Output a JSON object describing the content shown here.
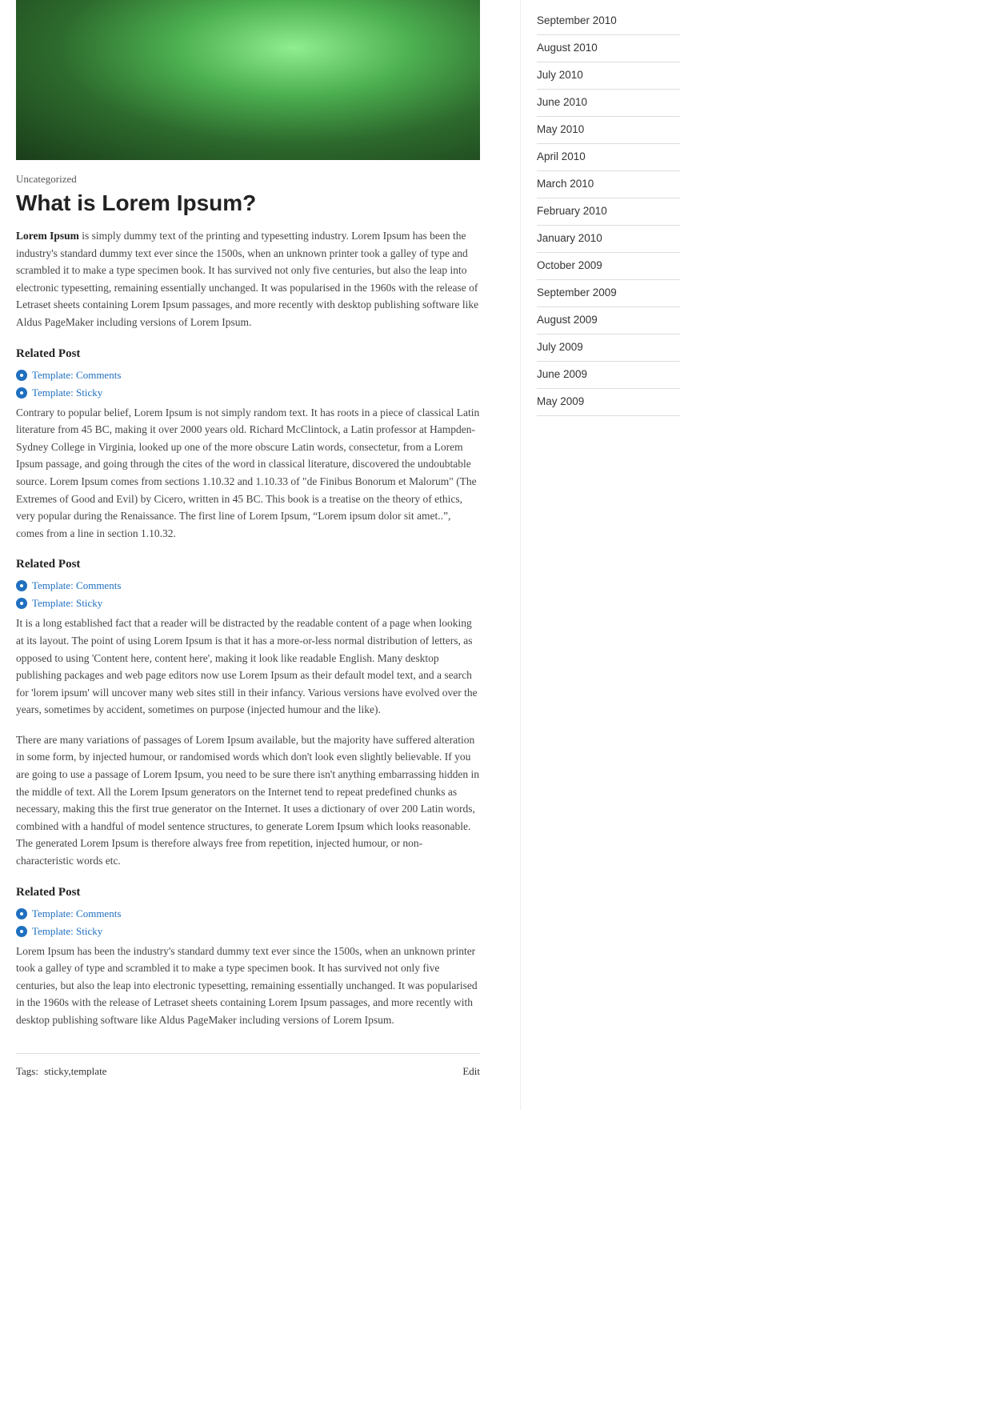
{
  "hero": {
    "alt": "Lorem Ipsum hero image"
  },
  "post": {
    "category": "Uncategorized",
    "title": "What is Lorem Ipsum?",
    "body1": "Lorem Ipsum is simply dummy text of the printing and typesetting industry. Lorem Ipsum has been the industry's standard dummy text ever since the 1500s, when an unknown printer took a galley of type and scrambled it to make a type specimen book. It has survived not only five centuries, but also the leap into electronic typesetting, remaining essentially unchanged. It was popularised in the 1960s with the release of Letraset sheets containing Lorem Ipsum passages, and more recently with desktop publishing software like Aldus PageMaker including versions of Lorem Ipsum.",
    "related_post_1": "Related Post",
    "related_link_1a": "Template: Comments",
    "related_link_1b": "Template: Sticky",
    "body2": "Contrary to popular belief, Lorem Ipsum is not simply random text. It has roots in a piece of classical Latin literature from 45 BC, making it over 2000 years old. Richard McClintock, a Latin professor at Hampden-Sydney College in Virginia, looked up one of the more obscure Latin words, consectetur, from a Lorem Ipsum passage, and going through the cites of the word in classical literature, discovered the undoubtable source. Lorem Ipsum comes from sections 1.10.32 and 1.10.33 of \"de Finibus Bonorum et Malorum\" (The Extremes of Good and Evil) by Cicero, written in 45 BC. This book is a treatise on the theory of ethics, very popular during the Renaissance. The first line of Lorem Ipsum, “Lorem ipsum dolor sit amet..”, comes from a line in section 1.10.32.",
    "related_post_2": "Related Post",
    "related_link_2a": "Template: Comments",
    "related_link_2b": "Template: Sticky",
    "body3": "It is a long established fact that a reader will be distracted by the readable content of a page when looking at its layout. The point of using Lorem Ipsum is that it has a more-or-less normal distribution of letters, as opposed to using 'Content here, content here', making it look like readable English. Many desktop publishing packages and web page editors now use Lorem Ipsum as their default model text, and a search for 'lorem ipsum' will uncover many web sites still in their infancy. Various versions have evolved over the years, sometimes by accident, sometimes on purpose (injected humour and the like).",
    "body4": "There are many variations of passages of Lorem Ipsum available, but the majority have suffered alteration in some form, by injected humour, or randomised words which don't look even slightly believable. If you are going to use a passage of Lorem Ipsum, you need to be sure there isn't anything embarrassing hidden in the middle of text. All the Lorem Ipsum generators on the Internet tend to repeat predefined chunks as necessary, making this the first true generator on the Internet. It uses a dictionary of over 200 Latin words, combined with a handful of model sentence structures, to generate Lorem Ipsum which looks reasonable. The generated Lorem Ipsum is therefore always free from repetition, injected humour, or non-characteristic words etc.",
    "related_post_3": "Related Post",
    "related_link_3a": "Template: Comments",
    "related_link_3b": "Template: Sticky",
    "body5": "Lorem Ipsum has been the industry's standard dummy text ever since the 1500s, when an unknown printer took a galley of type and scrambled it to make a type specimen book. It has survived not only five centuries, but also the leap into electronic typesetting, remaining essentially unchanged. It was popularised in the 1960s with the release of Letraset sheets containing Lorem Ipsum passages, and more recently with desktop publishing software like Aldus PageMaker including versions of Lorem Ipsum.",
    "tags_label": "Tags:",
    "tags_value": "sticky,template",
    "edit_label": "Edit"
  },
  "sidebar": {
    "archive_items": [
      {
        "label": "September 2010",
        "href": "#"
      },
      {
        "label": "August 2010",
        "href": "#"
      },
      {
        "label": "July 2010",
        "href": "#"
      },
      {
        "label": "June 2010",
        "href": "#"
      },
      {
        "label": "May 2010",
        "href": "#"
      },
      {
        "label": "April 2010",
        "href": "#"
      },
      {
        "label": "March 2010",
        "href": "#"
      },
      {
        "label": "February 2010",
        "href": "#"
      },
      {
        "label": "January 2010",
        "href": "#"
      },
      {
        "label": "October 2009",
        "href": "#"
      },
      {
        "label": "September 2009",
        "href": "#"
      },
      {
        "label": "August 2009",
        "href": "#"
      },
      {
        "label": "July 2009",
        "href": "#"
      },
      {
        "label": "June 2009",
        "href": "#"
      },
      {
        "label": "May 2009",
        "href": "#"
      }
    ]
  }
}
